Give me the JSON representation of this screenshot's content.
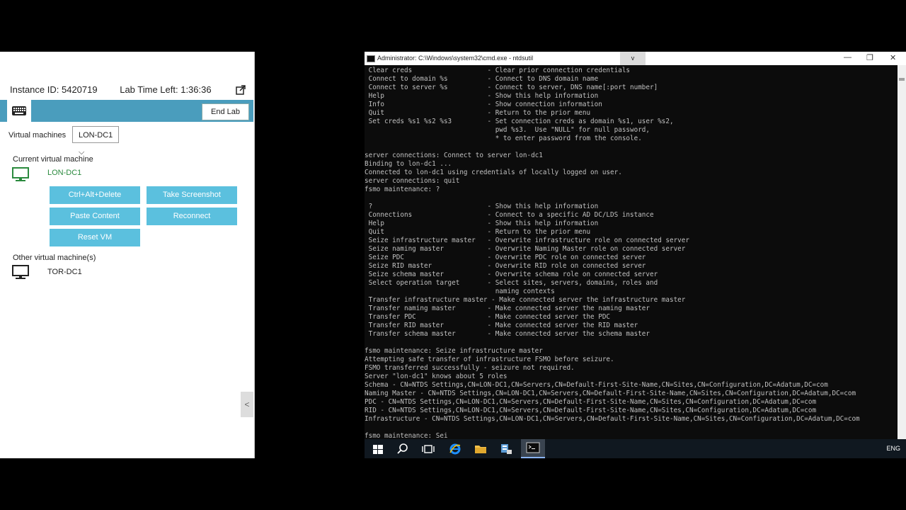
{
  "lab_panel": {
    "instance_id": "Instance ID: 5420719",
    "time_left": "Lab Time Left: 1:36:36",
    "end_lab_label": "End Lab",
    "vm_label": "Virtual machines",
    "vm_selected": "LON-DC1",
    "current_vm_title": "Current virtual machine",
    "current_vm_name": "LON-DC1",
    "buttons": {
      "ctrl_alt_del": "Ctrl+Alt+Delete",
      "screenshot": "Take Screenshot",
      "paste": "Paste Content",
      "reconnect": "Reconnect",
      "reset": "Reset VM"
    },
    "other_vm_title": "Other virtual machine(s)",
    "other_vm_name": "TOR-DC1",
    "collapse_label": "<"
  },
  "cmd": {
    "title": "Administrator: C:\\Windows\\system32\\cmd.exe - ntdsutil",
    "rdp_tab_label": "v",
    "lines": [
      " Clear creds                   - Clear prior connection credentials",
      " Connect to domain %s          - Connect to DNS domain name",
      " Connect to server %s          - Connect to server, DNS name[:port number]",
      " Help                          - Show this help information",
      " Info                          - Show connection information",
      " Quit                          - Return to the prior menu",
      " Set creds %s1 %s2 %s3         - Set connection creds as domain %s1, user %s2,",
      "                                 pwd %s3.  Use \"NULL\" for null password,",
      "                                 * to enter password from the console.",
      "",
      "server connections: Connect to server lon-dc1",
      "Binding to lon-dc1 ...",
      "Connected to lon-dc1 using credentials of locally logged on user.",
      "server connections: quit",
      "fsmo maintenance: ?",
      "",
      " ?                             - Show this help information",
      " Connections                   - Connect to a specific AD DC/LDS instance",
      " Help                          - Show this help information",
      " Quit                          - Return to the prior menu",
      " Seize infrastructure master   - Overwrite infrastructure role on connected server",
      " Seize naming master           - Overwrite Naming Master role on connected server",
      " Seize PDC                     - Overwrite PDC role on connected server",
      " Seize RID master              - Overwrite RID role on connected server",
      " Seize schema master           - Overwrite schema role on connected server",
      " Select operation target       - Select sites, servers, domains, roles and",
      "                                 naming contexts",
      " Transfer infrastructure master - Make connected server the infrastructure master",
      " Transfer naming master        - Make connected server the naming master",
      " Transfer PDC                  - Make connected server the PDC",
      " Transfer RID master           - Make connected server the RID master",
      " Transfer schema master        - Make connected server the schema master",
      "",
      "fsmo maintenance: Seize infrastructure master",
      "Attempting safe transfer of infrastructure FSMO before seizure.",
      "FSMO transferred successfully - seizure not required.",
      "Server \"lon-dc1\" knows about 5 roles",
      "Schema - CN=NTDS Settings,CN=LON-DC1,CN=Servers,CN=Default-First-Site-Name,CN=Sites,CN=Configuration,DC=Adatum,DC=com",
      "Naming Master - CN=NTDS Settings,CN=LON-DC1,CN=Servers,CN=Default-First-Site-Name,CN=Sites,CN=Configuration,DC=Adatum,DC=com",
      "PDC - CN=NTDS Settings,CN=LON-DC1,CN=Servers,CN=Default-First-Site-Name,CN=Sites,CN=Configuration,DC=Adatum,DC=com",
      "RID - CN=NTDS Settings,CN=LON-DC1,CN=Servers,CN=Default-First-Site-Name,CN=Sites,CN=Configuration,DC=Adatum,DC=com",
      "Infrastructure - CN=NTDS Settings,CN=LON-DC1,CN=Servers,CN=Default-First-Site-Name,CN=Sites,CN=Configuration,DC=Adatum,DC=com",
      "",
      "fsmo maintenance: Sei_"
    ]
  },
  "taskbar": {
    "language": "ENG",
    "icons": [
      "windows-start-icon",
      "search-icon",
      "task-view-icon",
      "internet-explorer-icon",
      "file-explorer-icon",
      "server-manager-icon",
      "cmd-icon"
    ]
  },
  "colors": {
    "toolbar": "#4a9dbd",
    "action_button": "#5bc0de",
    "current_vm": "#2b8a3e"
  }
}
